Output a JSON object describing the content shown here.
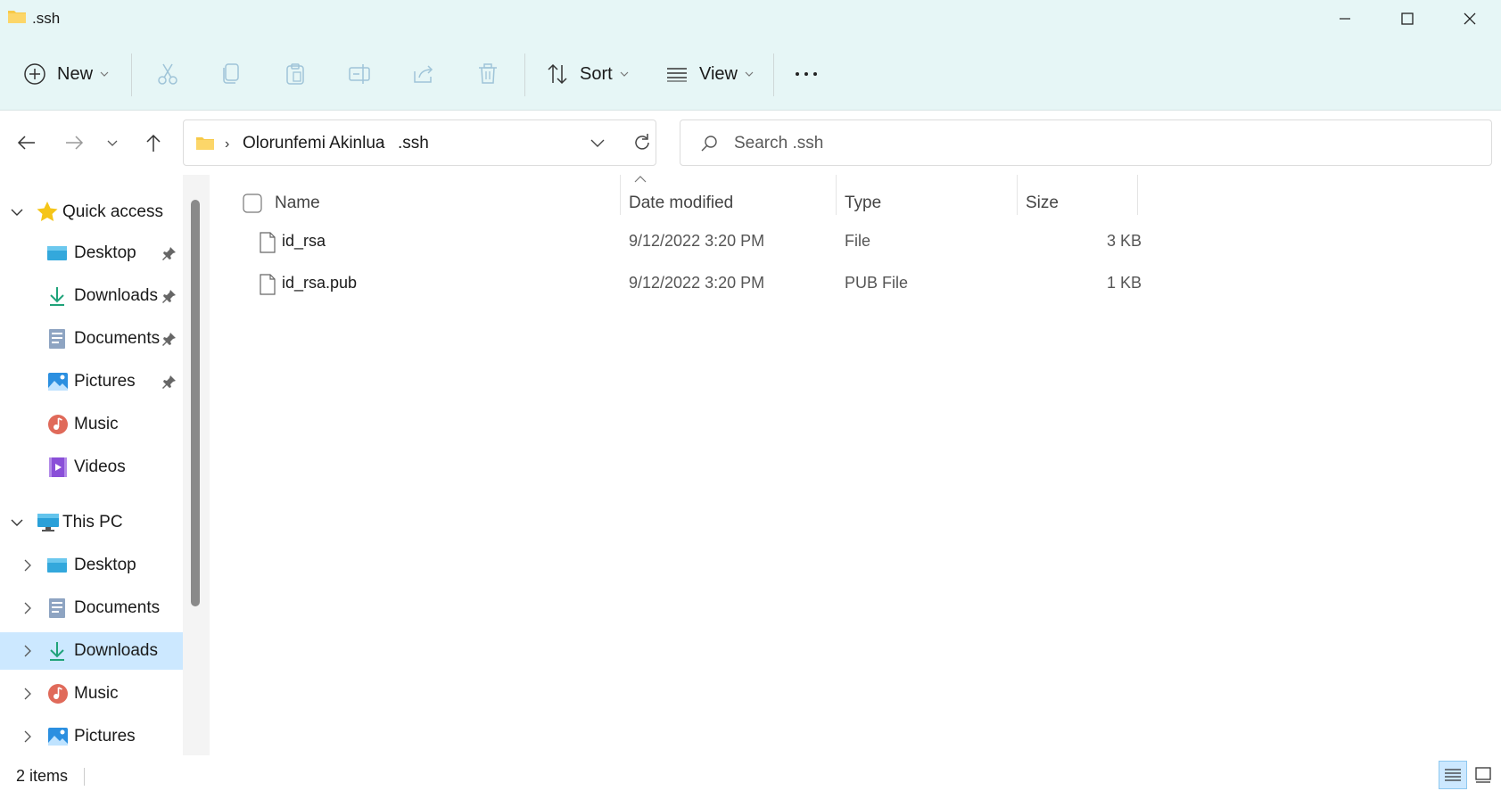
{
  "window": {
    "title": ".ssh"
  },
  "toolbar": {
    "new_label": "New",
    "sort_label": "Sort",
    "view_label": "View"
  },
  "address": {
    "segments": [
      "Olorunfemi Akinlua",
      ".ssh"
    ]
  },
  "search": {
    "placeholder": "Search .ssh"
  },
  "sidebar": {
    "quick_access": {
      "label": "Quick access",
      "items": [
        {
          "label": "Desktop",
          "icon": "desktop-icon",
          "pinned": true
        },
        {
          "label": "Downloads",
          "icon": "downloads-icon",
          "pinned": true
        },
        {
          "label": "Documents",
          "icon": "documents-icon",
          "pinned": true
        },
        {
          "label": "Pictures",
          "icon": "pictures-icon",
          "pinned": true
        },
        {
          "label": "Music",
          "icon": "music-icon",
          "pinned": false
        },
        {
          "label": "Videos",
          "icon": "videos-icon",
          "pinned": false
        }
      ]
    },
    "this_pc": {
      "label": "This PC",
      "items": [
        {
          "label": "Desktop",
          "icon": "desktop-icon"
        },
        {
          "label": "Documents",
          "icon": "documents-icon"
        },
        {
          "label": "Downloads",
          "icon": "downloads-icon",
          "selected": true
        },
        {
          "label": "Music",
          "icon": "music-icon"
        },
        {
          "label": "Pictures",
          "icon": "pictures-icon"
        }
      ]
    }
  },
  "columns": {
    "name": "Name",
    "date": "Date modified",
    "type": "Type",
    "size": "Size"
  },
  "files": [
    {
      "name": "id_rsa",
      "date": "9/12/2022 3:20 PM",
      "type": "File",
      "size": "3 KB"
    },
    {
      "name": "id_rsa.pub",
      "date": "9/12/2022 3:20 PM",
      "type": "PUB File",
      "size": "1 KB"
    }
  ],
  "status": {
    "items": "2 items"
  },
  "colors": {
    "titlebar": "#e6f6f6",
    "selection": "#cce8ff",
    "accent": "#0078d4"
  }
}
